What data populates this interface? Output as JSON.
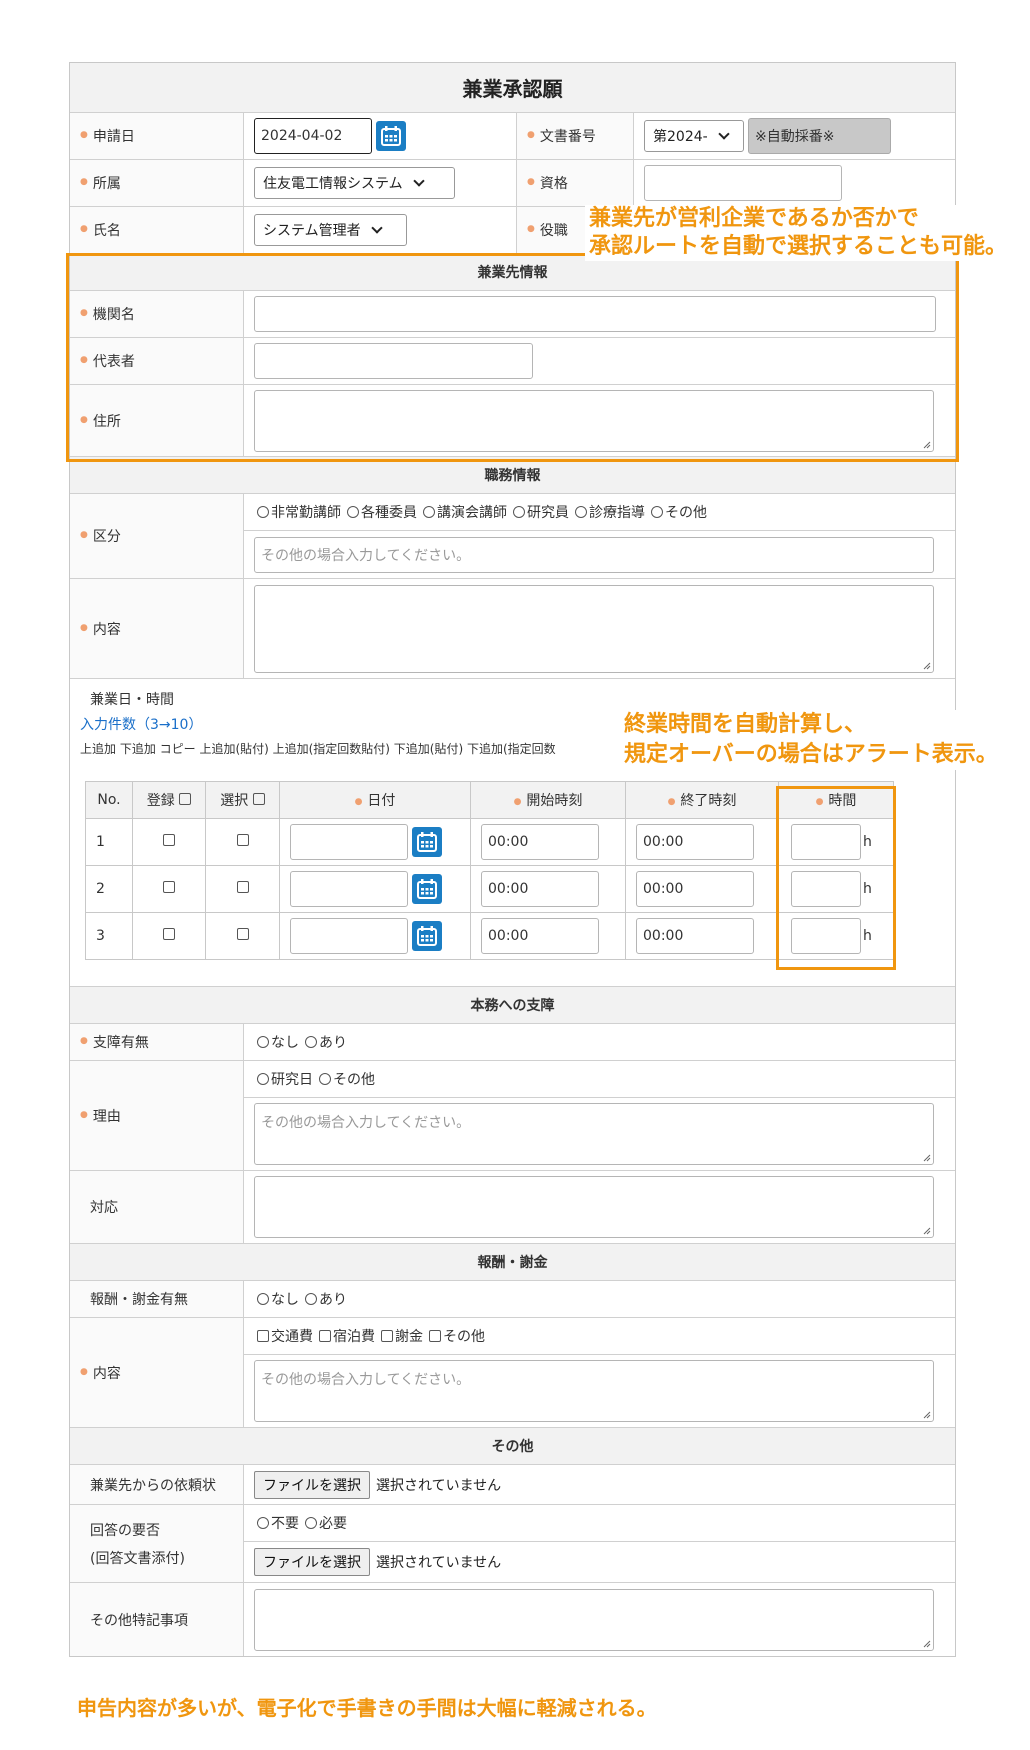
{
  "form": {
    "title": "兼業承認願",
    "row1": {
      "date_label": "申請日",
      "date_value": "2024-04-02",
      "docno_label": "文書番号",
      "docno_select": "第2024-",
      "docno_auto": "※自動採番※"
    },
    "row2": {
      "org_label": "所属",
      "org_select": "住友電工情報システム",
      "qual_label": "資格"
    },
    "row3": {
      "name_label": "氏名",
      "name_select": "システム管理者",
      "role_label": "役職"
    }
  },
  "section_employer": {
    "header": "兼業先情報",
    "org_label": "機関名",
    "rep_label": "代表者",
    "address_label": "住所"
  },
  "section_duty": {
    "header": "職務情報",
    "kind_label": "区分",
    "kind_options": [
      "非常勤講師",
      "各種委員",
      "講演会講師",
      "研究員",
      "診療指導",
      "その他"
    ],
    "kind_other_placeholder": "その他の場合入力してください。",
    "content_label": "内容"
  },
  "schedule": {
    "heading": "兼業日・時間",
    "count_link": "入力件数（3→10）",
    "actions": "上追加 下追加 コピー 上追加(貼付) 上追加(指定回数貼付) 下追加(貼付) 下追加(指定回数",
    "headers": {
      "no": "No.",
      "reg": "登録",
      "sel": "選択",
      "date": "日付",
      "start": "開始時刻",
      "end": "終了時刻",
      "hours": "時間"
    },
    "rows": [
      {
        "no": "1",
        "start": "00:00",
        "end": "00:00",
        "unit": "h"
      },
      {
        "no": "2",
        "start": "00:00",
        "end": "00:00",
        "unit": "h"
      },
      {
        "no": "3",
        "start": "00:00",
        "end": "00:00",
        "unit": "h"
      }
    ]
  },
  "section_impact": {
    "header": "本務への支障",
    "has_label": "支障有無",
    "has_options": [
      "なし",
      "あり"
    ],
    "reason_label": "理由",
    "reason_options": [
      "研究日",
      "その他"
    ],
    "reason_placeholder": "その他の場合入力してください。",
    "response_label": "対応"
  },
  "section_reward": {
    "header": "報酬・謝金",
    "has_label": "報酬・謝金有無",
    "has_options": [
      "なし",
      "あり"
    ],
    "content_label": "内容",
    "content_options": [
      "交通費",
      "宿泊費",
      "謝金",
      "その他"
    ],
    "content_placeholder": "その他の場合入力してください。"
  },
  "section_other": {
    "header": "その他",
    "request_label": "兼業先からの依頼状",
    "file_button": "ファイルを選択",
    "file_status": "選択されていません",
    "reply_label_1": "回答の要否",
    "reply_label_2": "(回答文書添付)",
    "reply_options": [
      "不要",
      "必要"
    ],
    "notes_label": "その他特記事項"
  },
  "annotations": {
    "a1_line1": "兼業先が営利企業であるか否かで",
    "a1_line2": "承認ルートを自動で選択することも可能。",
    "a2_line1": "終業時間を自動計算し、",
    "a2_line2": "規定オーバーの場合はアラート表示。",
    "a3": "申告内容が多いが、電子化で手書きの手間は大幅に軽減される。"
  },
  "colors": {
    "accent_orange": "#f0960f",
    "calendar_blue": "#1b7ec4",
    "link_blue": "#1a6fc9",
    "required_dot": "#f0a070"
  }
}
